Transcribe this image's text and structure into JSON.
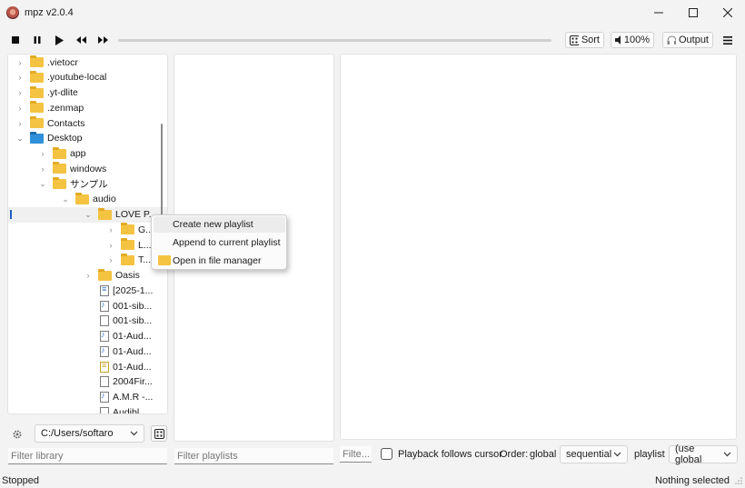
{
  "window": {
    "title": "mpz v2.0.4"
  },
  "toolbar": {
    "sort_label": "Sort",
    "volume_label": "100%",
    "output_label": "Output"
  },
  "tree": {
    "items": [
      {
        "label": ".vietocr",
        "depth": 0,
        "expander": "›",
        "icon": "folder"
      },
      {
        "label": ".youtube-local",
        "depth": 0,
        "expander": "›",
        "icon": "folder"
      },
      {
        "label": ".yt-dlite",
        "depth": 0,
        "expander": "›",
        "icon": "folder"
      },
      {
        "label": ".zenmap",
        "depth": 0,
        "expander": "›",
        "icon": "folder"
      },
      {
        "label": "Contacts",
        "depth": 0,
        "expander": "›",
        "icon": "folder"
      },
      {
        "label": "Desktop",
        "depth": 0,
        "expander": "⌄",
        "icon": "folder-blue"
      },
      {
        "label": "app",
        "depth": 1,
        "expander": "›",
        "icon": "folder"
      },
      {
        "label": "windows",
        "depth": 1,
        "expander": "›",
        "icon": "folder"
      },
      {
        "label": "サンプル",
        "depth": 1,
        "expander": "⌄",
        "icon": "folder"
      },
      {
        "label": "audio",
        "depth": 2,
        "expander": "⌄",
        "icon": "folder"
      },
      {
        "label": "LOVE P...",
        "depth": 3,
        "expander": "⌄",
        "icon": "folder",
        "active": true
      },
      {
        "label": "G...",
        "depth": 4,
        "expander": "›",
        "icon": "folder"
      },
      {
        "label": "L...",
        "depth": 4,
        "expander": "›",
        "icon": "folder"
      },
      {
        "label": "T...",
        "depth": 4,
        "expander": "›",
        "icon": "folder"
      },
      {
        "label": "Oasis",
        "depth": 3,
        "expander": "›",
        "icon": "folder"
      },
      {
        "label": "[2025-1...",
        "depth": 3,
        "expander": "",
        "icon": "file-text"
      },
      {
        "label": "001-sib...",
        "depth": 3,
        "expander": "",
        "icon": "file-audio"
      },
      {
        "label": "001-sib...",
        "depth": 3,
        "expander": "",
        "icon": "file"
      },
      {
        "label": "01-Aud...",
        "depth": 3,
        "expander": "",
        "icon": "file-audio"
      },
      {
        "label": "01-Aud...",
        "depth": 3,
        "expander": "",
        "icon": "file-audio"
      },
      {
        "label": "01-Aud...",
        "depth": 3,
        "expander": "",
        "icon": "file-cue"
      },
      {
        "label": "2004Fir...",
        "depth": 3,
        "expander": "",
        "icon": "file"
      },
      {
        "label": "A.M.R -...",
        "depth": 3,
        "expander": "",
        "icon": "file-audio"
      },
      {
        "label": "Audibl...",
        "depth": 3,
        "expander": "",
        "icon": "file"
      }
    ]
  },
  "context_menu": {
    "items": [
      {
        "label": "Create new playlist"
      },
      {
        "label": "Append to current playlist"
      },
      {
        "label": "Open in file manager"
      }
    ]
  },
  "library": {
    "path": "C:/Users/softaro",
    "filter_placeholder": "Filter library"
  },
  "playlists": {
    "filter_placeholder": "Filter playlists"
  },
  "tracks": {
    "filter_placeholder": "Filte...",
    "follow_cursor_label": "Playback follows cursor",
    "order_label": "Order:",
    "order_scope": "global",
    "order_value": "sequential",
    "playlist_label": "playlist",
    "playlist_value": "(use global"
  },
  "status": {
    "left": "Stopped",
    "right": "Nothing selected"
  }
}
